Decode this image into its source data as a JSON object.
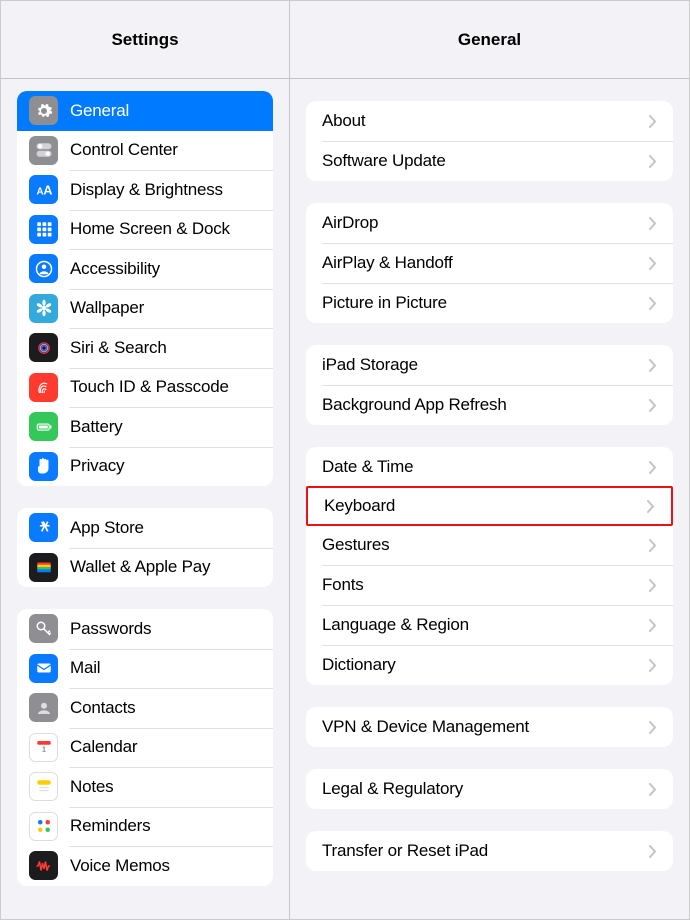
{
  "sidebar": {
    "title": "Settings",
    "groups": [
      [
        {
          "label": "General",
          "icon": "gear",
          "bg": "bg-grey",
          "selected": true
        },
        {
          "label": "Control Center",
          "icon": "toggles",
          "bg": "bg-grey"
        },
        {
          "label": "Display & Brightness",
          "icon": "aa",
          "bg": "bg-blue"
        },
        {
          "label": "Home Screen & Dock",
          "icon": "grid",
          "bg": "bg-blue"
        },
        {
          "label": "Accessibility",
          "icon": "person",
          "bg": "bg-blue"
        },
        {
          "label": "Wallpaper",
          "icon": "flower",
          "bg": "bg-teal"
        },
        {
          "label": "Siri & Search",
          "icon": "siri",
          "bg": "bg-dark"
        },
        {
          "label": "Touch ID & Passcode",
          "icon": "finger",
          "bg": "bg-red"
        },
        {
          "label": "Battery",
          "icon": "battery",
          "bg": "bg-green"
        },
        {
          "label": "Privacy",
          "icon": "hand",
          "bg": "bg-blue"
        }
      ],
      [
        {
          "label": "App Store",
          "icon": "appstore",
          "bg": "bg-blue"
        },
        {
          "label": "Wallet & Apple Pay",
          "icon": "wallet",
          "bg": "bg-dark"
        }
      ],
      [
        {
          "label": "Passwords",
          "icon": "key",
          "bg": "bg-grey"
        },
        {
          "label": "Mail",
          "icon": "mail",
          "bg": "bg-blue"
        },
        {
          "label": "Contacts",
          "icon": "contact",
          "bg": "bg-grey2"
        },
        {
          "label": "Calendar",
          "icon": "calendar",
          "bg": "bg-white"
        },
        {
          "label": "Notes",
          "icon": "notes",
          "bg": "bg-white"
        },
        {
          "label": "Reminders",
          "icon": "reminders",
          "bg": "bg-white"
        },
        {
          "label": "Voice Memos",
          "icon": "voice",
          "bg": "bg-dark"
        }
      ]
    ]
  },
  "main": {
    "title": "General",
    "groups": [
      [
        {
          "label": "About"
        },
        {
          "label": "Software Update"
        }
      ],
      [
        {
          "label": "AirDrop"
        },
        {
          "label": "AirPlay & Handoff"
        },
        {
          "label": "Picture in Picture"
        }
      ],
      [
        {
          "label": "iPad Storage"
        },
        {
          "label": "Background App Refresh"
        }
      ],
      [
        {
          "label": "Date & Time"
        },
        {
          "label": "Keyboard",
          "highlight": true
        },
        {
          "label": "Gestures"
        },
        {
          "label": "Fonts"
        },
        {
          "label": "Language & Region"
        },
        {
          "label": "Dictionary"
        }
      ],
      [
        {
          "label": "VPN & Device Management"
        }
      ],
      [
        {
          "label": "Legal & Regulatory"
        }
      ],
      [
        {
          "label": "Transfer or Reset iPad"
        }
      ]
    ]
  }
}
